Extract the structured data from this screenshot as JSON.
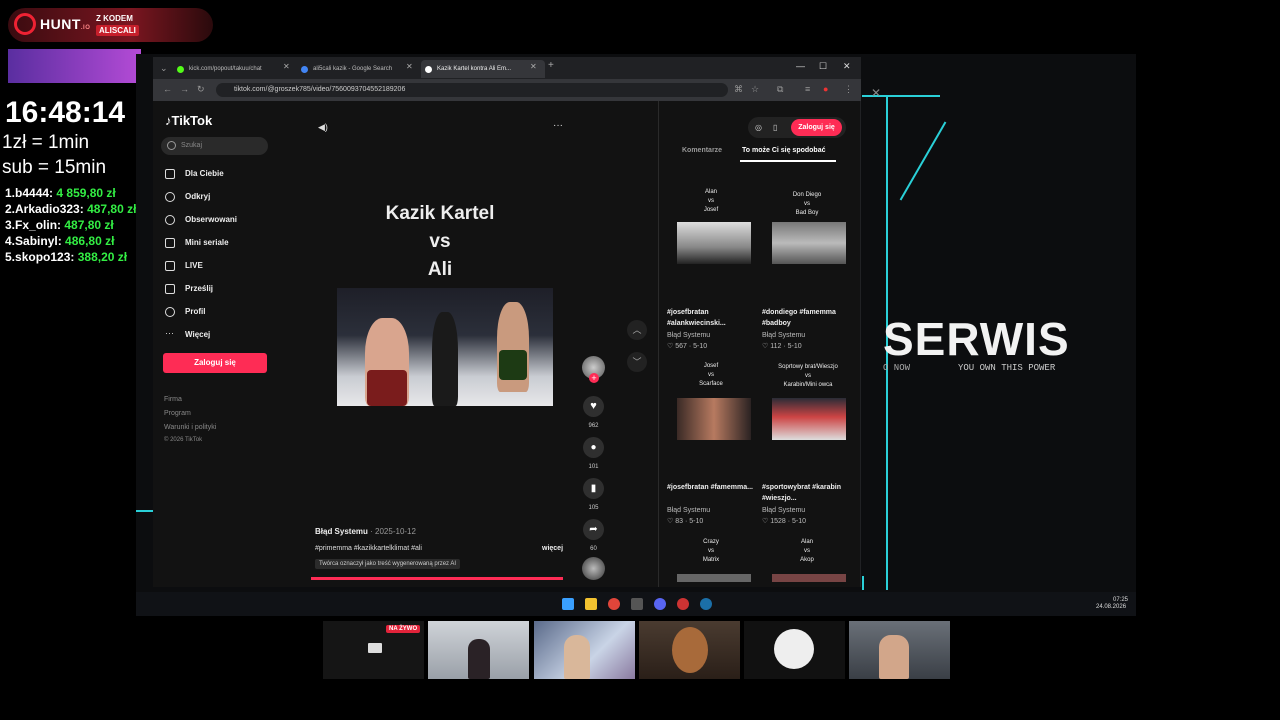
{
  "overlay": {
    "brand": "HUNT",
    "brand_suffix": ".IO",
    "code_title": "Z KODEM",
    "code": "ALISCALI",
    "clock": "16:48:14",
    "rate_line1": "1zł = 1min",
    "rate_line2": "sub = 15min",
    "leaderboard": [
      {
        "rank": "1.",
        "name": "b4444:",
        "amount": "4 859,80 zł"
      },
      {
        "rank": "2.",
        "name": "Arkadio323:",
        "amount": "487,80 zł"
      },
      {
        "rank": "3.",
        "name": "Fx_olin:",
        "amount": "487,80 zł"
      },
      {
        "rank": "4.",
        "name": "Sabinyl:",
        "amount": "486,80 zł"
      },
      {
        "rank": "5.",
        "name": "skopo123:",
        "amount": "388,20 zł"
      }
    ]
  },
  "wallpaper": {
    "title": "SERWIS",
    "sub1": "O NOW",
    "sub2": "YOU OWN THIS POWER"
  },
  "browser": {
    "tabs": [
      {
        "label": "kick.com/popout/takuu/chat",
        "color": "#53fc18"
      },
      {
        "label": "ali5cali kazik - Google Search",
        "color": "#4285f4"
      },
      {
        "label": "Kazik Kartel kontra Ali Em...",
        "color": "#ffffff"
      }
    ],
    "url": "tiktok.com/@groszek785/video/7560093704552189206"
  },
  "tiktok": {
    "logo": "TikTok",
    "search_placeholder": "Szukaj",
    "nav": [
      "Dla Ciebie",
      "Odkryj",
      "Obserwowani",
      "Mini seriale",
      "LIVE",
      "Prześlij",
      "Profil",
      "Więcej"
    ],
    "login": "Zaloguj się",
    "footer": [
      "Firma",
      "Program",
      "Warunki i polityki",
      "© 2026 TikTok"
    ],
    "video_title": [
      "Kazik Kartel",
      "vs",
      "Ali"
    ],
    "author": "Błąd Systemu",
    "date": "· 2025-10-12",
    "tags": "#primemma #kazikkartelklimat #ali",
    "more": "więcej",
    "ai_notice": "Twórca oznaczył jako treść wygenerowaną przez AI",
    "counts": {
      "likes": "962",
      "comments": "101",
      "saves": "105",
      "shares": "60"
    }
  },
  "panel": {
    "login": "Zaloguj się",
    "tab_comments": "Komentarze",
    "tab_recommend": "To może Ci się spodobać",
    "items": [
      {
        "title": "Alan\nvs\nJosef",
        "tags": "#josefbratan #alankwiecinski...",
        "author": "Błąd Systemu",
        "stats": "♡ 567 · 5-10"
      },
      {
        "title": "Don Diego\nvs\nBad Boy",
        "tags": "#dondiego #famemma #badboy",
        "author": "Błąd Systemu",
        "stats": "♡ 112 · 5-10"
      },
      {
        "title": "Josef\nvs\nScarface",
        "tags": "#josefbratan #famemma...",
        "author": "Błąd Systemu",
        "stats": "♡ 83 · 5-10"
      },
      {
        "title": "Soprtowy brat/Wieszjo\nvs\nKarabin/Mini owca",
        "tags": "#sportowybrat #karabin #wieszjo...",
        "author": "Błąd Systemu",
        "stats": "♡ 1528 · 5-10"
      },
      {
        "title": "Crazy\nvs\nMatrix"
      },
      {
        "title": "Alan\nvs\nAkop"
      }
    ]
  },
  "taskbar": {
    "time": "07:25",
    "date": "24.08.2026"
  },
  "cams": {
    "live_badge": "NA ŻYWO"
  }
}
